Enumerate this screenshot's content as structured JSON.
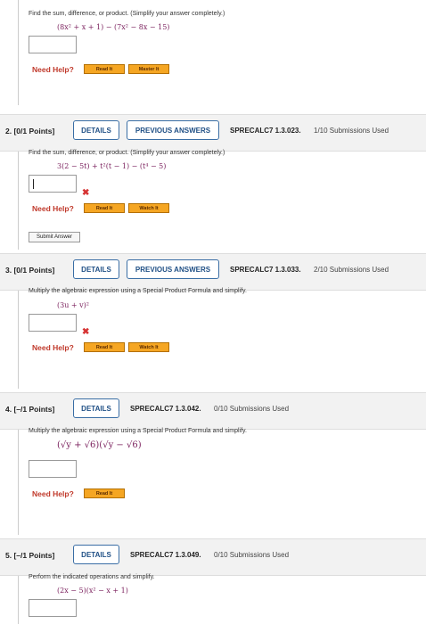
{
  "q1": {
    "instruction": "Find the sum, difference, or product. (Simplify your answer completely.)",
    "expr": "(8x² + x + 1) − (7x² − 8x − 15)",
    "help_label": "Need Help?",
    "read_label": "Read It",
    "master_label": "Master It"
  },
  "q2": {
    "number": "2.",
    "points": "[0/1 Points]",
    "details_label": "DETAILS",
    "prev_label": "PREVIOUS ANSWERS",
    "id": "SPRECALC7 1.3.023.",
    "submissions": "1/10 Submissions Used",
    "instruction": "Find the sum, difference, or product. (Simplify your answer completely.)",
    "expr": "3(2 − 5t) + t²(t − 1) − (t⁴ − 5)",
    "help_label": "Need Help?",
    "read_label": "Read It",
    "watch_label": "Watch It",
    "submit_label": "Submit Answer"
  },
  "q3": {
    "number": "3.",
    "points": "[0/1 Points]",
    "details_label": "DETAILS",
    "prev_label": "PREVIOUS ANSWERS",
    "id": "SPRECALC7 1.3.033.",
    "submissions": "2/10 Submissions Used",
    "instruction": "Multiply the algebraic expression using a Special Product Formula and simplify.",
    "expr": "(3u + v)²",
    "help_label": "Need Help?",
    "read_label": "Read It",
    "watch_label": "Watch It"
  },
  "q4": {
    "number": "4.",
    "points": "[–/1 Points]",
    "details_label": "DETAILS",
    "id": "SPRECALC7 1.3.042.",
    "submissions": "0/10 Submissions Used",
    "instruction": "Multiply the algebraic expression using a Special Product Formula and simplify.",
    "expr": "(√y + √6)(√y − √6)",
    "help_label": "Need Help?",
    "read_label": "Read It"
  },
  "q5": {
    "number": "5.",
    "points": "[–/1 Points]",
    "details_label": "DETAILS",
    "id": "SPRECALC7 1.3.049.",
    "submissions": "0/10 Submissions Used",
    "instruction": "Perform the indicated operations and simplify.",
    "expr": "(2x − 5)(x² − x + 1)"
  },
  "colors": {
    "help": "#c0392b",
    "accent_button": "#f5a623",
    "details_border": "#3a6ea5",
    "wrong_mark": "#d63333",
    "expr": "#7a1f5c"
  }
}
